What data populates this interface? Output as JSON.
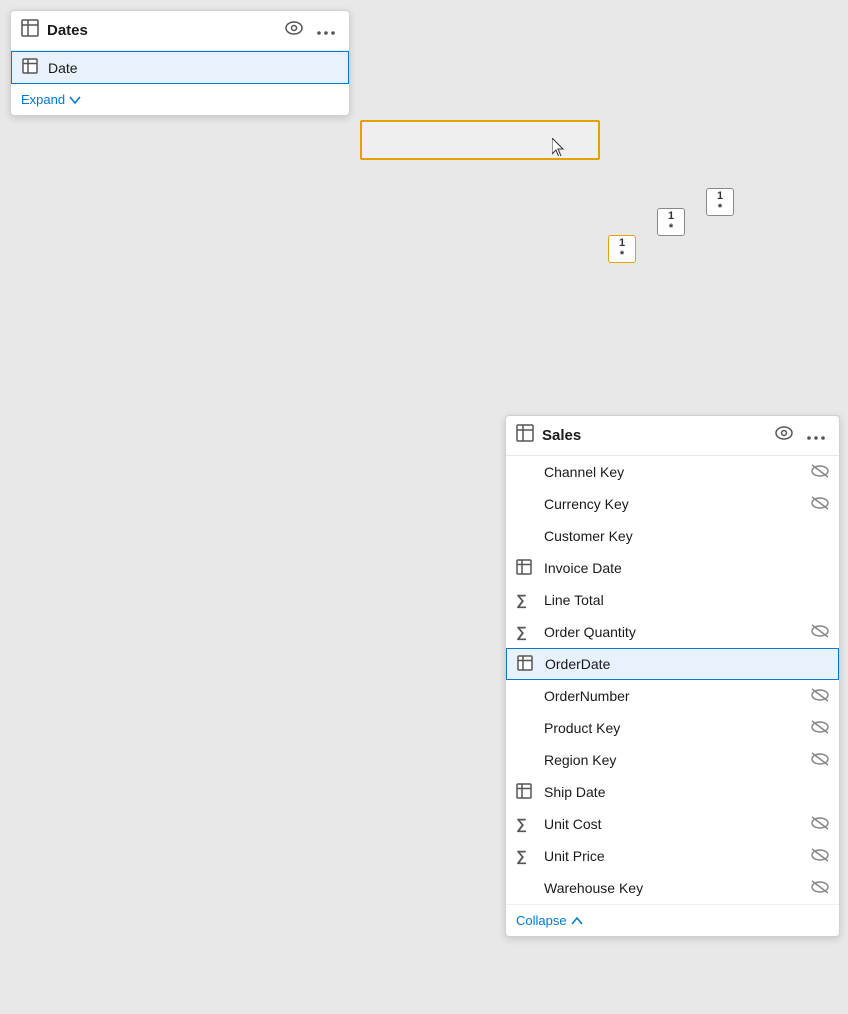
{
  "datesCard": {
    "title": "Dates",
    "rows": [
      {
        "id": "date-row",
        "label": "Date",
        "icon": "table",
        "selected": true
      }
    ],
    "expandLabel": "Expand"
  },
  "salesCard": {
    "title": "Sales",
    "rows": [
      {
        "id": "channel-key",
        "label": "Channel Key",
        "icon": "none",
        "hidden": true,
        "selected": false
      },
      {
        "id": "currency-key",
        "label": "Currency Key",
        "icon": "none",
        "hidden": true,
        "selected": false
      },
      {
        "id": "customer-key",
        "label": "Customer Key",
        "icon": "none",
        "hidden": false,
        "selected": false
      },
      {
        "id": "invoice-date",
        "label": "Invoice Date",
        "icon": "table",
        "hidden": false,
        "selected": false
      },
      {
        "id": "line-total",
        "label": "Line Total",
        "icon": "sigma",
        "hidden": false,
        "selected": false
      },
      {
        "id": "order-quantity",
        "label": "Order Quantity",
        "icon": "sigma",
        "hidden": true,
        "selected": false
      },
      {
        "id": "order-date",
        "label": "OrderDate",
        "icon": "table",
        "hidden": false,
        "selected": true
      },
      {
        "id": "order-number",
        "label": "OrderNumber",
        "icon": "none",
        "hidden": true,
        "selected": false
      },
      {
        "id": "product-key",
        "label": "Product Key",
        "icon": "none",
        "hidden": true,
        "selected": false
      },
      {
        "id": "region-key",
        "label": "Region Key",
        "icon": "none",
        "hidden": true,
        "selected": false
      },
      {
        "id": "ship-date",
        "label": "Ship Date",
        "icon": "table",
        "hidden": false,
        "selected": false
      },
      {
        "id": "unit-cost",
        "label": "Unit Cost",
        "icon": "sigma",
        "hidden": true,
        "selected": false
      },
      {
        "id": "unit-price",
        "label": "Unit Price",
        "icon": "sigma",
        "hidden": true,
        "selected": false
      },
      {
        "id": "warehouse-key",
        "label": "Warehouse Key",
        "icon": "none",
        "hidden": true,
        "selected": false
      }
    ],
    "collapseLabel": "Collapse"
  },
  "badges": {
    "b1": {
      "top": "1",
      "bottom": "*"
    },
    "b2": {
      "top": "1",
      "bottom": "*"
    },
    "b3": {
      "top": "1",
      "bottom": "*"
    }
  },
  "icons": {
    "eye": "👁",
    "more": "⋯",
    "eyeSlash": "🚫",
    "chevronDown": "∨",
    "chevronUp": "∧"
  }
}
